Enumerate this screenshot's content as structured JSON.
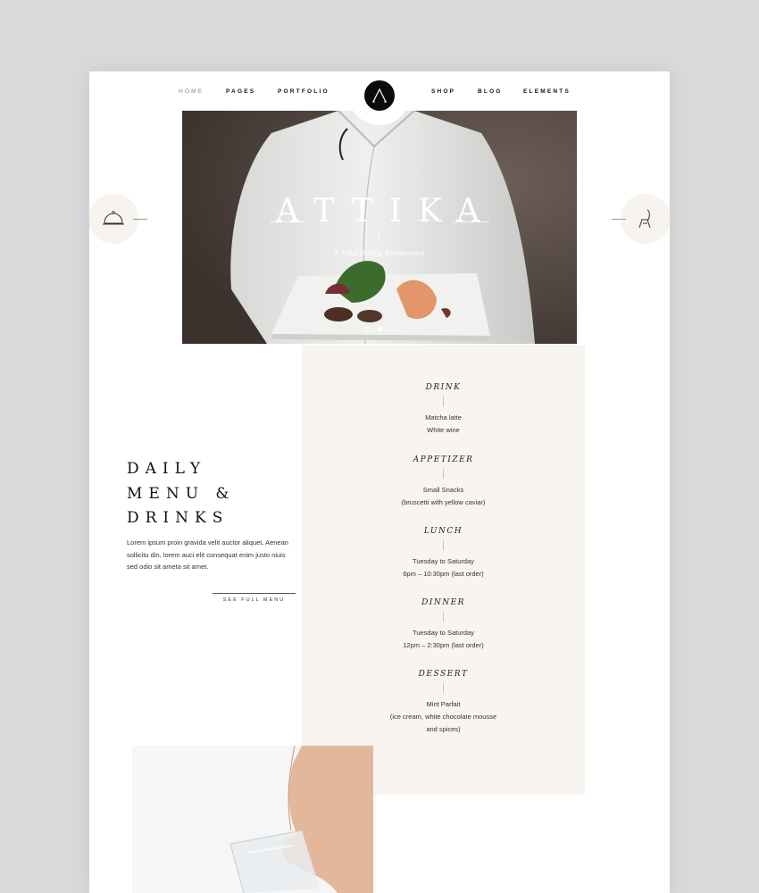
{
  "nav": {
    "left_items": [
      "HOME",
      "PAGES",
      "PORTFOLIO"
    ],
    "right_items": [
      "SHOP",
      "BLOG",
      "ELEMENTS"
    ],
    "active": "HOME",
    "logo_icon": "letter-a-logo"
  },
  "hero": {
    "title": "ATTIKA",
    "subtitle": "A Fine Dining Restaurant",
    "slide_count": 3,
    "active_slide": 2
  },
  "side_nav": {
    "left_icon": "cloche-icon",
    "right_icon": "chair-icon"
  },
  "intro": {
    "heading_lines": [
      "DAILY",
      "MENU &",
      "DRINKS"
    ],
    "body": "Lorem ipsum proin gravida velit auctor aliquet. Aenean sollicitu din, lorem auci elit consequat enim justo niuis sed odio sit ameta sit amet.",
    "link": "SEE FULL MENU"
  },
  "menu": {
    "sections": [
      {
        "title": "DRINK",
        "lines": [
          "Matcha latte",
          "White wine"
        ]
      },
      {
        "title": "APPETIZER",
        "lines": [
          "Small Snacks",
          "(bruscetti with yellow caviar)"
        ]
      },
      {
        "title": "LUNCH",
        "lines": [
          "Tuesday to Saturday",
          "6pm – 10:30pm (last order)"
        ]
      },
      {
        "title": "DINNER",
        "lines": [
          "Tuesday to Saturday",
          "12pm – 2:30pm (last order)"
        ]
      },
      {
        "title": "DESSERT",
        "lines": [
          "Mint Parfait",
          "(ice cream, white chocolate mousse",
          "and spices)"
        ]
      }
    ]
  },
  "colors": {
    "page_bg": "#d9d9da",
    "panel_bg": "#f8f4f0",
    "logo_bg": "#0b0b0b",
    "hero_bg": "#4a403b"
  }
}
